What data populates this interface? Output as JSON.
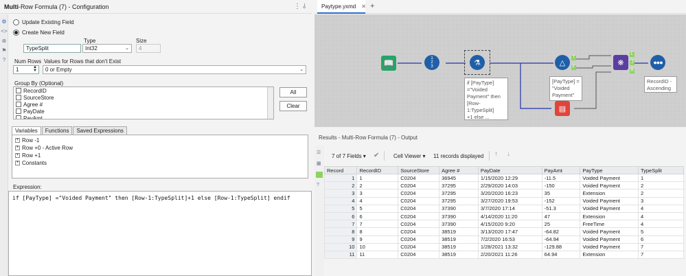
{
  "config": {
    "title_bold": "Multi",
    "title_rest": "-Row Formula (7) - Configuration",
    "update_existing_label": "Update Existing Field",
    "create_new_label": "Create New  Field",
    "field_name": "TypeSplit",
    "type_label": "Type",
    "type_value": "Int32",
    "size_label": "Size",
    "size_value": "4",
    "num_rows_label": "Num Rows",
    "num_rows_value": "1",
    "values_label": "Values for Rows that don't Exist",
    "values_value": "0 or Empty",
    "group_by_label": "Group By (Optional)",
    "group_by_items": [
      "RecordID",
      "SourceStore",
      "Agree #",
      "PayDate",
      "PayAmt"
    ],
    "all_button": "All",
    "clear_button": "Clear",
    "tabs": [
      "Variables",
      "Functions",
      "Saved Expressions"
    ],
    "variables": [
      "Row -1",
      "Row +0 - Active Row",
      "Row +1",
      "Constants"
    ],
    "expression_label": "Expression:",
    "expression": "if [PayType] =\"Voided Payment\" then [Row-1:TypeSplit]+1 else [Row-1:TypeSplit] endif"
  },
  "canvas": {
    "file_tab": "Paytype.yxmd",
    "add_tab": "+",
    "note_formula": "if [PayType]\n=\"Voided\nPayment\" then\n[Row-1:TypeSplit]\n+1 else ...",
    "note_filter": "[PayType] =\n\"Voided\nPayment\"",
    "note_sort": "RecordID -\nAscending",
    "filter_t": "T",
    "filter_f": "F",
    "join_l": "L",
    "join_j": "J",
    "join_r": "R"
  },
  "results": {
    "title": "Results - Multi-Row Formula (7) - Output",
    "fields_label": "7 of 7 Fields",
    "viewer_label": "Cell Viewer",
    "records_label": "11 records displayed",
    "columns": [
      "Record",
      "RecordID",
      "SourceStore",
      "Agree #",
      "PayDate",
      "PayAmt",
      "PayType",
      "TypeSplit"
    ],
    "rows": [
      [
        "1",
        "1",
        "C0204",
        "36945",
        "1/15/2020 12:29",
        "-11.5",
        "Voided Payment",
        "1"
      ],
      [
        "2",
        "2",
        "C0204",
        "37295",
        "2/29/2020 14:03",
        "-150",
        "Voided Payment",
        "2"
      ],
      [
        "3",
        "3",
        "C0204",
        "37295",
        "3/20/2020 16:23",
        "35",
        "Extension",
        "2"
      ],
      [
        "4",
        "4",
        "C0204",
        "37295",
        "3/27/2020 19:53",
        "-152",
        "Voided Payment",
        "3"
      ],
      [
        "5",
        "5",
        "C0204",
        "37390",
        "3/7/2020 17:14",
        "-51.3",
        "Voided Payment",
        "4"
      ],
      [
        "6",
        "6",
        "C0204",
        "37390",
        "4/14/2020 11:20",
        "47",
        "Extension",
        "4"
      ],
      [
        "7",
        "7",
        "C0204",
        "37390",
        "4/15/2020 9:20",
        "25",
        "FreeTime",
        "4"
      ],
      [
        "8",
        "8",
        "C0204",
        "38519",
        "3/13/2020 17:47",
        "-64.82",
        "Voided Payment",
        "5"
      ],
      [
        "9",
        "9",
        "C0204",
        "38519",
        "7/2/2020 16:53",
        "-64.94",
        "Voided Payment",
        "6"
      ],
      [
        "10",
        "10",
        "C0204",
        "38519",
        "1/28/2021 13:32",
        "-129.88",
        "Voided Payment",
        "7"
      ],
      [
        "11",
        "11",
        "C0204",
        "38519",
        "2/20/2021 11:26",
        "64.94",
        "Extension",
        "7"
      ]
    ]
  },
  "colors": {
    "input_tool": "#27a36b",
    "recordid_tool": "#1f5fa8",
    "multirow_tool": "#1f5fa8",
    "filter_tool": "#1f5fa8",
    "join_tool": "#5a3fa0",
    "sort_tool": "#1f5fa8",
    "union_tool": "#e0453b",
    "link": "#2233aa",
    "port": "#8dd35f"
  }
}
